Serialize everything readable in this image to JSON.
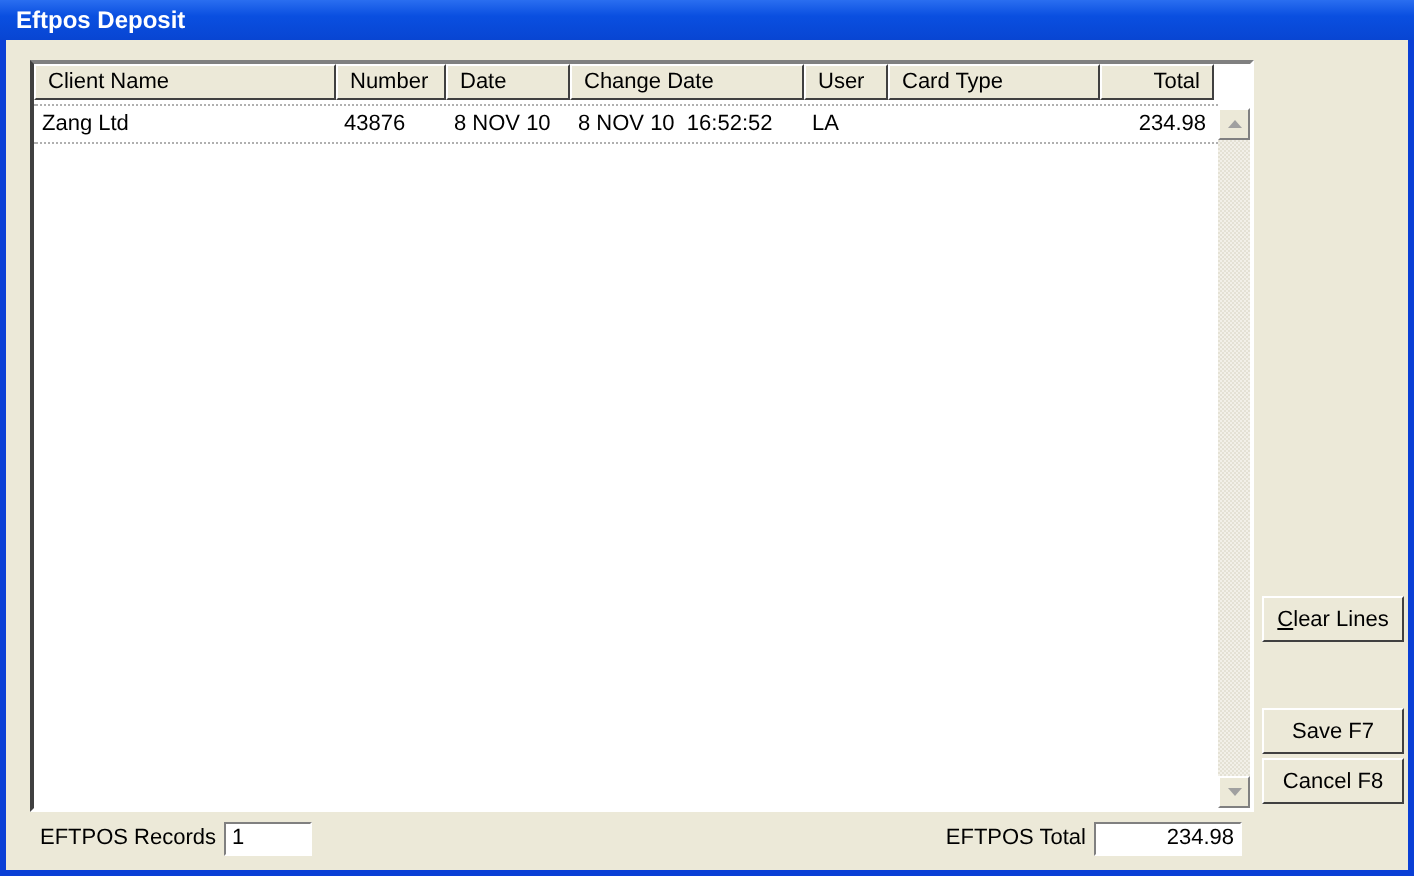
{
  "window": {
    "title": "Eftpos Deposit"
  },
  "table": {
    "columns": [
      "Client Name",
      "Number",
      "Date",
      "Change Date",
      "User",
      "Card Type",
      "Total"
    ],
    "rows": [
      [
        "Zang Ltd",
        "43876",
        "8 NOV 10",
        "8 NOV 10  16:52:52",
        "LA",
        "",
        "234.98"
      ]
    ]
  },
  "side_buttons": {
    "upper": [
      {
        "label": "Clear Lines",
        "mnemonic": true
      }
    ],
    "lower": [
      {
        "label": "Save F7",
        "mnemonic": false
      },
      {
        "label": "Cancel F8",
        "mnemonic": false
      }
    ]
  },
  "footer": {
    "records_label": "EFTPOS Records",
    "records_value": "1",
    "total_label": "EFTPOS Total",
    "total_value": "234.98"
  }
}
